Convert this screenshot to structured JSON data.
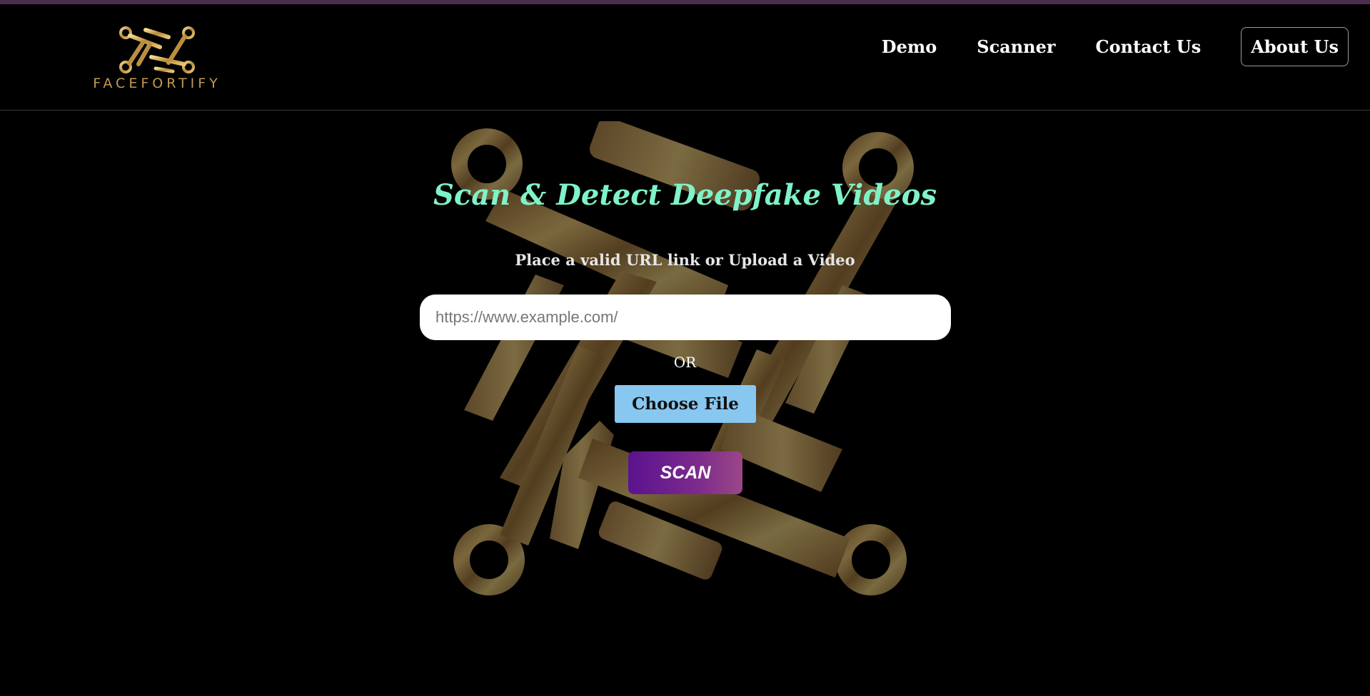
{
  "brand": {
    "name": "FACEFORTIFY",
    "logo_icon": "facefortify-logo-icon"
  },
  "nav": {
    "items": [
      {
        "label": "Demo"
      },
      {
        "label": "Scanner"
      },
      {
        "label": "Contact Us"
      },
      {
        "label": "About Us"
      }
    ]
  },
  "main": {
    "title": "Scan & Detect Deepfake Videos",
    "subtitle": "Place a valid URL link or Upload a Video",
    "url_input": {
      "placeholder": "https://www.example.com/",
      "value": ""
    },
    "or_label": "OR",
    "choose_file_label": "Choose File",
    "scan_label": "SCAN",
    "background_emblem": "facefortify-emblem-watermark"
  },
  "colors": {
    "title_accent": "#7ff3c7",
    "brand_gold": "#c19a53",
    "choose_file_bg": "#87c7f0",
    "scan_gradient_start": "#5b128f",
    "scan_gradient_end": "#9a4787",
    "top_strip": "#4b2e4f"
  }
}
